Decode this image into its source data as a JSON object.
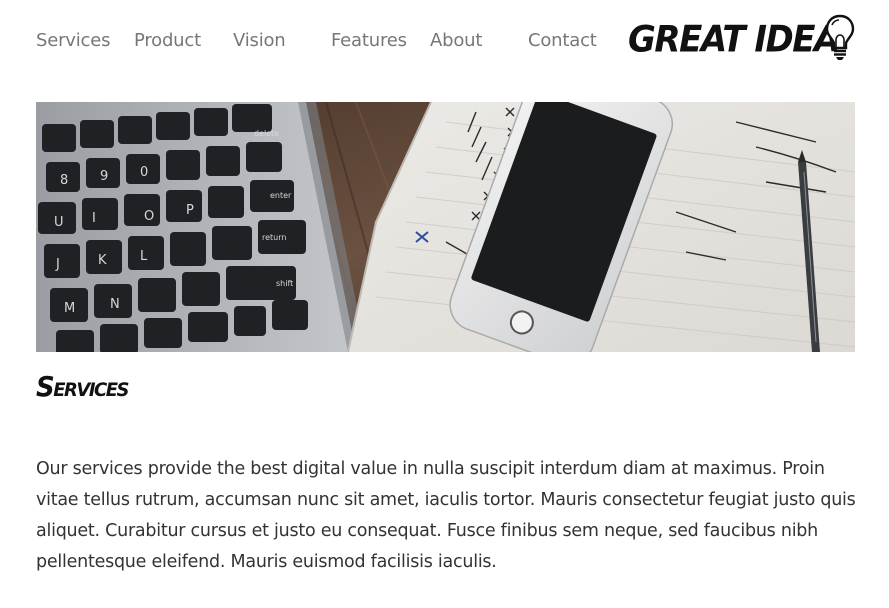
{
  "nav": {
    "items": [
      {
        "label": "Services"
      },
      {
        "label": "Product"
      },
      {
        "label": "Vision"
      },
      {
        "label": "Features"
      },
      {
        "label": "About"
      },
      {
        "label": "Contact"
      }
    ]
  },
  "logo": {
    "text": "GREAT IDEA",
    "icon": "lightbulb-icon"
  },
  "hero": {
    "image": "laptop-phone-notebook-photo"
  },
  "section": {
    "title": "Services",
    "body": "Our services provide the best digital value in nulla suscipit interdum diam at maximus. Proin vitae tellus rutrum, accumsan nunc sit amet, iaculis tortor. Mauris consectetur feugiat justo quis aliquet. Curabitur cursus et justo eu consequat. Fusce finibus sem neque, sed faucibus nibh pellentesque eleifend. Mauris euismod facilisis iaculis."
  },
  "colors": {
    "nav_text": "#777777",
    "body_text": "#333333",
    "heading": "#111111"
  }
}
